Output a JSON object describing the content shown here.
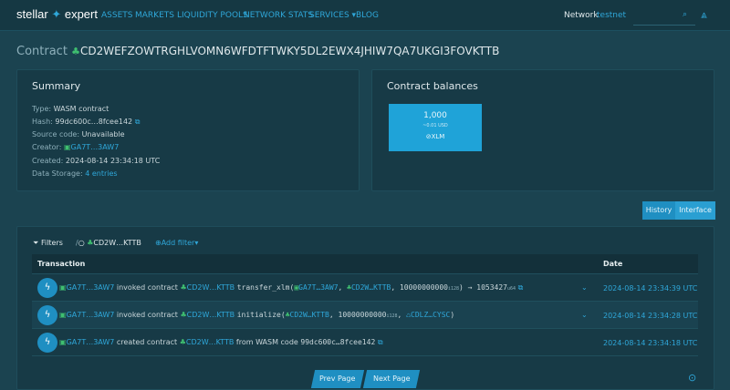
{
  "header": {
    "logo_left": "stellar",
    "logo_right": "expert",
    "nav": [
      "ASSETS",
      "MARKETS",
      "LIQUIDITY POOLS",
      "NETWORK STATS",
      "SERVICES",
      "BLOG"
    ],
    "network_label": "Network",
    "network_value": "testnet"
  },
  "contract": {
    "label": "Contract",
    "id": "CD2WEFZOWTRGHLVOMN6WFDTFTWKY5DL2EWX4JHIW7QA7UKGI3FOVKTTB"
  },
  "summary": {
    "title": "Summary",
    "type_label": "Type:",
    "type_value": "WASM contract",
    "hash_label": "Hash:",
    "hash_value": "99dc600c…8fcee142",
    "source_label": "Source code:",
    "source_value": "Unavailable",
    "creator_label": "Creator:",
    "creator_value": "GA7T…3AW7",
    "created_label": "Created:",
    "created_value": "2024-08-14 23:34:18 UTC",
    "storage_label": "Data Storage:",
    "storage_value": "4 entries"
  },
  "balances": {
    "title": "Contract balances",
    "amount": "1,000",
    "usd": "~0.01 USD",
    "asset": "XLM"
  },
  "tabs": {
    "history": "History",
    "interface": "Interface"
  },
  "filters": {
    "label": "Filters",
    "chip": "CD2W…KTTB",
    "add": "Add filter"
  },
  "table": {
    "col_tx": "Transaction",
    "col_date": "Date",
    "rows": [
      {
        "account": "GA7T…3AW7",
        "verb": "invoked contract",
        "contract": "CD2W…KTTB",
        "call_fn": "transfer_xlm(",
        "arg1": "GA7T…3AW7",
        "arg2": "CD2W…KTTB",
        "arg3": "10000000000",
        "arg3_type": "i128",
        "result_arrow": ") → 1053427",
        "result_type": "u64",
        "date": "2024-08-14 23:34:39 UTC"
      },
      {
        "account": "GA7T…3AW7",
        "verb": "invoked contract",
        "contract": "CD2W…KTTB",
        "call_fn": "initialize(",
        "arg1": "CD2W…KTTB",
        "arg2": "10000000000",
        "arg2_type": "i128",
        "arg3": "CDLZ…CYSC",
        "close": ")",
        "date": "2024-08-14 23:34:28 UTC"
      },
      {
        "account": "GA7T…3AW7",
        "verb": "created contract",
        "contract": "CD2W…KTTB",
        "from": "from WASM code",
        "code": "99dc600c…8fcee142",
        "date": "2024-08-14 23:34:18 UTC"
      }
    ]
  },
  "pagination": {
    "prev": "Prev Page",
    "next": "Next Page"
  },
  "colors": {
    "background": "#1b4350",
    "accent": "#2fa7d9",
    "button": "#1f8fc2"
  }
}
